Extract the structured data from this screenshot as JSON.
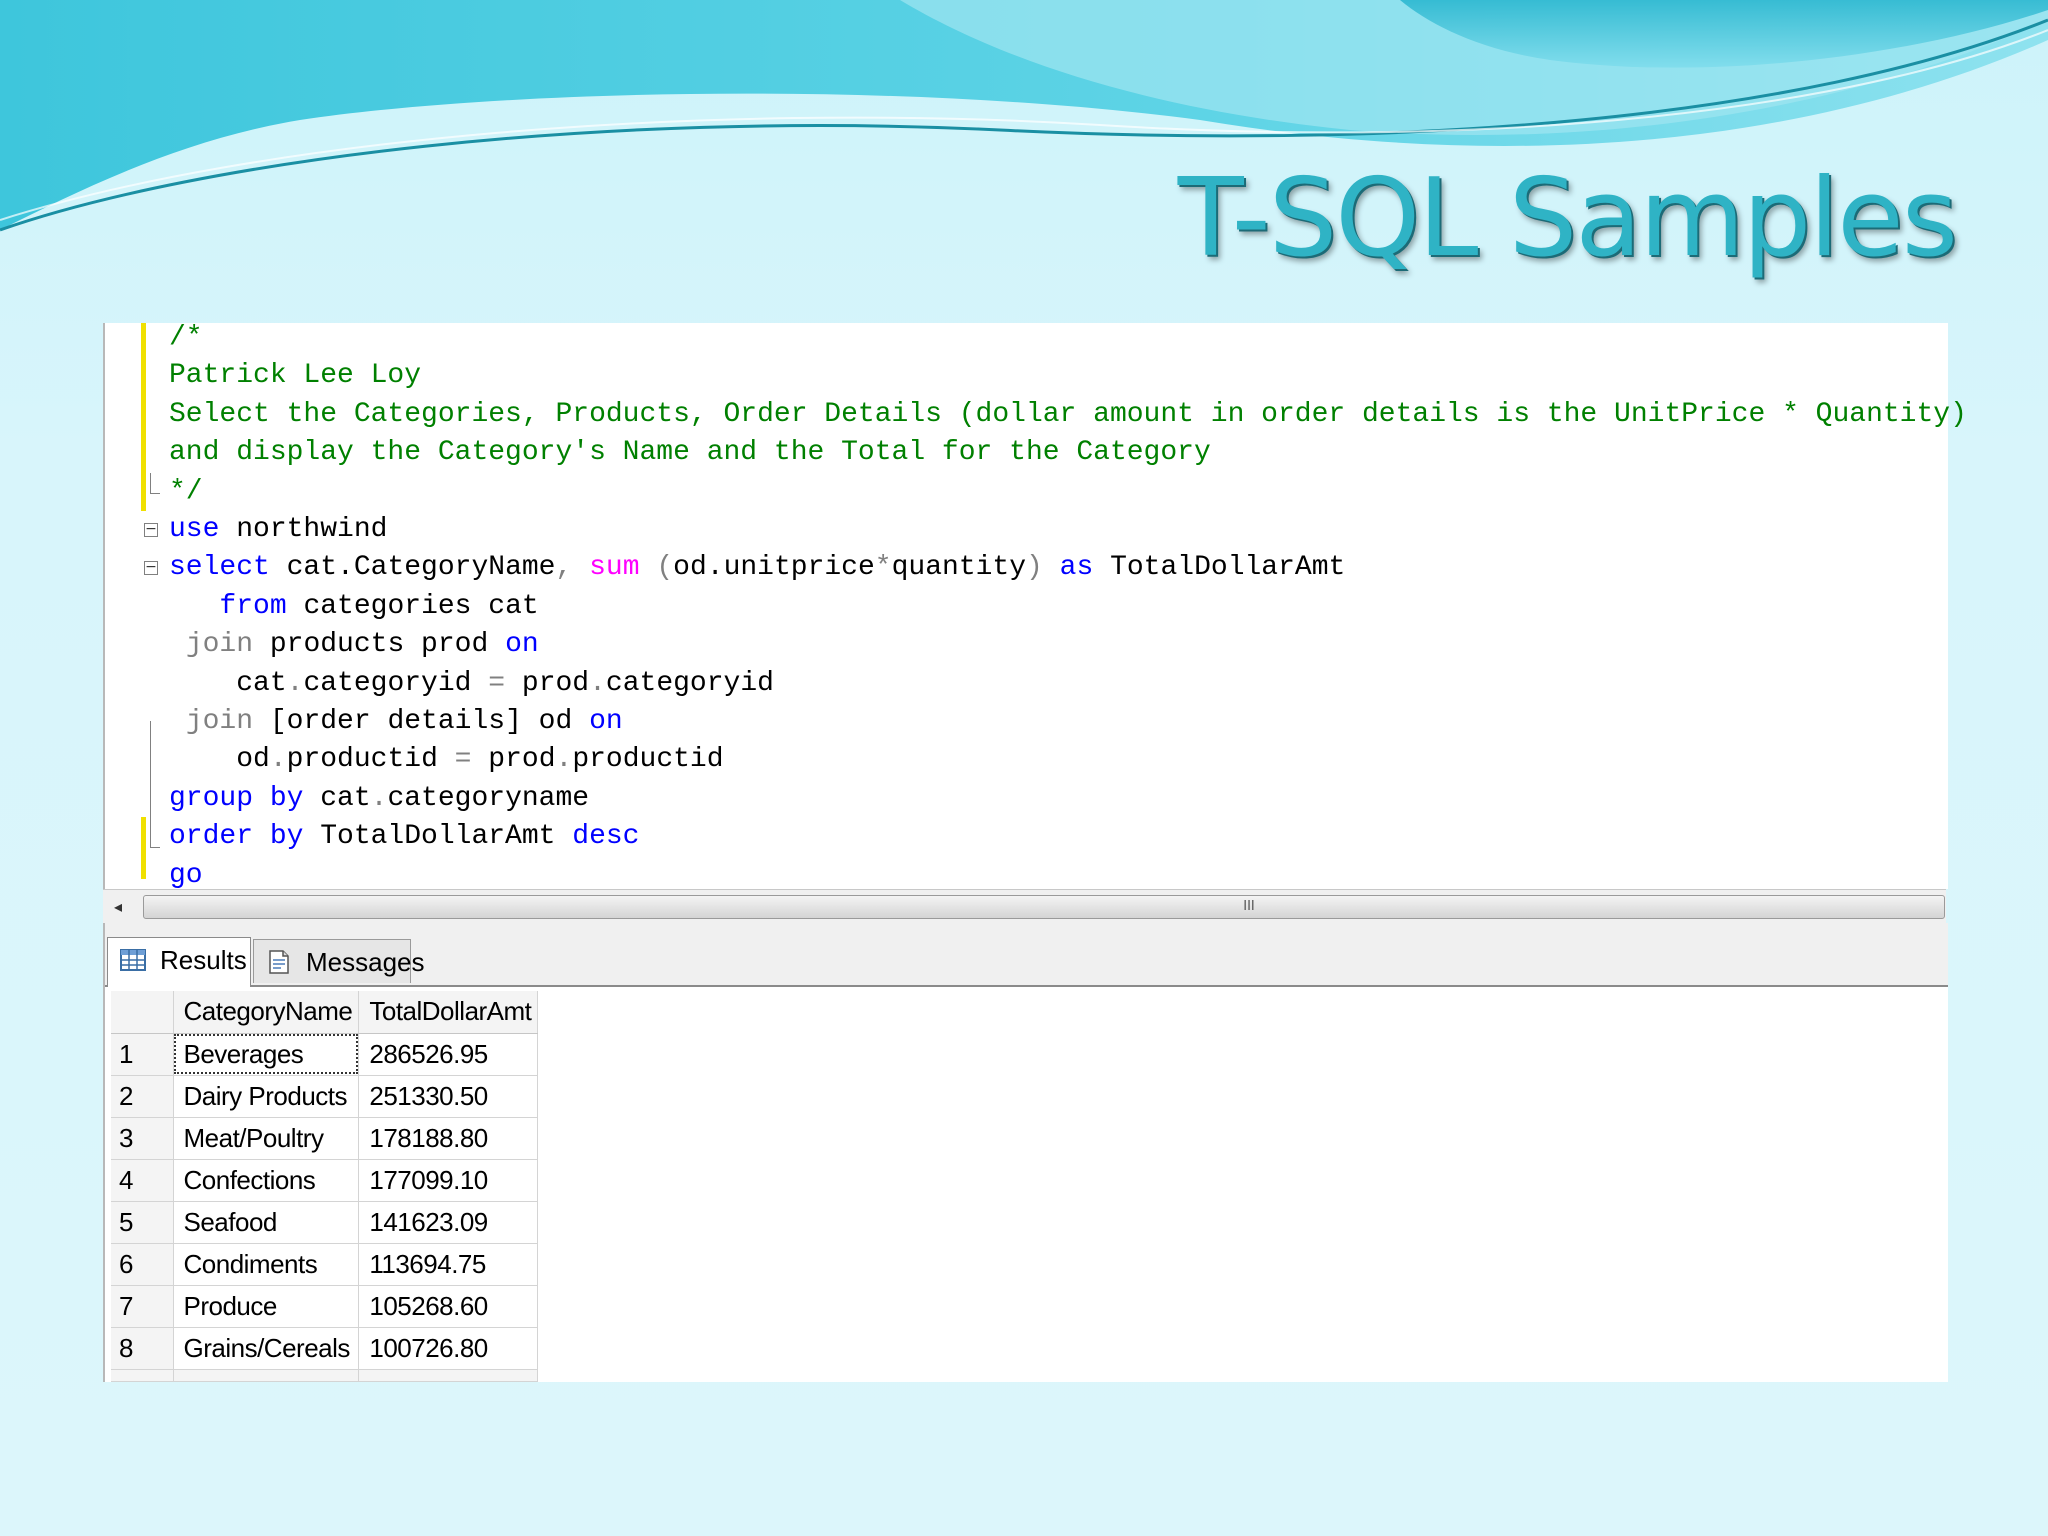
{
  "slide": {
    "title": "T-SQL Samples",
    "colors": {
      "title": "#2fb3c5",
      "background": "#d8f5fb",
      "wave": "#4cc8de"
    }
  },
  "editor": {
    "lines": [
      [
        {
          "t": "/*",
          "c": "comment"
        }
      ],
      [
        {
          "t": "Patrick Lee Loy",
          "c": "comment"
        }
      ],
      [
        {
          "t": "Select the Categories, Products, Order Details (dollar amount in order details is the UnitPrice * Quantity)",
          "c": "comment"
        }
      ],
      [
        {
          "t": "and display the Category's Name and the Total for the Category",
          "c": "comment"
        }
      ],
      [
        {
          "t": "*/",
          "c": "comment"
        }
      ],
      [
        {
          "t": "use",
          "c": "kw"
        },
        {
          "t": " northwind",
          "c": ""
        }
      ],
      [
        {
          "t": "select",
          "c": "kw"
        },
        {
          "t": " cat.CategoryName",
          "c": ""
        },
        {
          "t": ",",
          "c": "op"
        },
        {
          "t": " ",
          "c": ""
        },
        {
          "t": "sum",
          "c": "fn"
        },
        {
          "t": " ",
          "c": ""
        },
        {
          "t": "(",
          "c": "op"
        },
        {
          "t": "od.unitprice",
          "c": ""
        },
        {
          "t": "*",
          "c": "op"
        },
        {
          "t": "quantity",
          "c": ""
        },
        {
          "t": ")",
          "c": "op"
        },
        {
          "t": " ",
          "c": ""
        },
        {
          "t": "as",
          "c": "kw"
        },
        {
          "t": " TotalDollarAmt",
          "c": ""
        }
      ],
      [
        {
          "t": "   ",
          "c": ""
        },
        {
          "t": "from",
          "c": "kw"
        },
        {
          "t": " categories cat",
          "c": ""
        }
      ],
      [
        {
          "t": " ",
          "c": ""
        },
        {
          "t": "join",
          "c": "op"
        },
        {
          "t": " products prod ",
          "c": ""
        },
        {
          "t": "on",
          "c": "kw"
        }
      ],
      [
        {
          "t": "    cat",
          "c": ""
        },
        {
          "t": ".",
          "c": "op"
        },
        {
          "t": "categoryid ",
          "c": ""
        },
        {
          "t": "=",
          "c": "op"
        },
        {
          "t": " prod",
          "c": ""
        },
        {
          "t": ".",
          "c": "op"
        },
        {
          "t": "categoryid",
          "c": ""
        }
      ],
      [
        {
          "t": " ",
          "c": ""
        },
        {
          "t": "join",
          "c": "op"
        },
        {
          "t": " [order details] od ",
          "c": ""
        },
        {
          "t": "on",
          "c": "kw"
        }
      ],
      [
        {
          "t": "    od",
          "c": ""
        },
        {
          "t": ".",
          "c": "op"
        },
        {
          "t": "productid ",
          "c": ""
        },
        {
          "t": "=",
          "c": "op"
        },
        {
          "t": " prod",
          "c": ""
        },
        {
          "t": ".",
          "c": "op"
        },
        {
          "t": "productid",
          "c": ""
        }
      ],
      [
        {
          "t": "group by",
          "c": "kw"
        },
        {
          "t": " cat",
          "c": ""
        },
        {
          "t": ".",
          "c": "op"
        },
        {
          "t": "categoryname",
          "c": ""
        }
      ],
      [
        {
          "t": "order by",
          "c": "kw"
        },
        {
          "t": " TotalDollarAmt ",
          "c": ""
        },
        {
          "t": "desc",
          "c": "kw"
        }
      ],
      [
        {
          "t": "go",
          "c": "kw"
        }
      ]
    ],
    "syntax_colors": {
      "comment": "#008000",
      "keyword": "#0000ff",
      "function": "#ff00ff",
      "operator": "#808080"
    }
  },
  "scrollbar": {
    "left_arrow": "◂",
    "grip": "III"
  },
  "results": {
    "tabs": [
      {
        "label": "Results",
        "icon": "grid-icon",
        "active": true
      },
      {
        "label": "Messages",
        "icon": "messages-icon",
        "active": false
      }
    ],
    "columns": [
      "CategoryName",
      "TotalDollarAmt"
    ],
    "rows": [
      {
        "num": "1",
        "CategoryName": "Beverages",
        "TotalDollarAmt": "286526.95"
      },
      {
        "num": "2",
        "CategoryName": "Dairy Products",
        "TotalDollarAmt": "251330.50"
      },
      {
        "num": "3",
        "CategoryName": "Meat/Poultry",
        "TotalDollarAmt": "178188.80"
      },
      {
        "num": "4",
        "CategoryName": "Confections",
        "TotalDollarAmt": "177099.10"
      },
      {
        "num": "5",
        "CategoryName": "Seafood",
        "TotalDollarAmt": "141623.09"
      },
      {
        "num": "6",
        "CategoryName": "Condiments",
        "TotalDollarAmt": "113694.75"
      },
      {
        "num": "7",
        "CategoryName": "Produce",
        "TotalDollarAmt": "105268.60"
      },
      {
        "num": "8",
        "CategoryName": "Grains/Cereals",
        "TotalDollarAmt": "100726.80"
      }
    ]
  }
}
